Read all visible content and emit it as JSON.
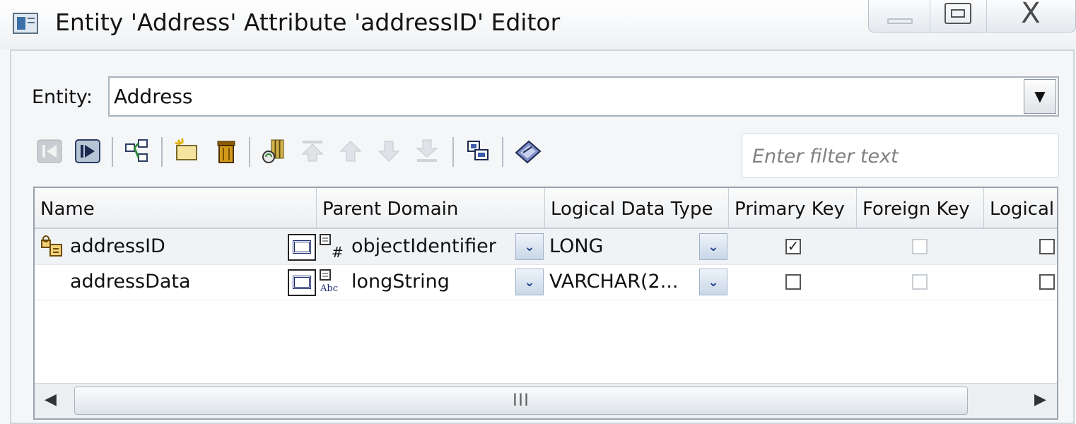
{
  "window": {
    "title": "Entity 'Address' Attribute 'addressID' Editor",
    "controls": {
      "minimize": "minimize",
      "maximize": "maximize",
      "close": "X"
    }
  },
  "entity": {
    "label": "Entity:",
    "value": "Address"
  },
  "toolbar": {
    "icons": [
      "previous-icon",
      "next-icon",
      "add-attribute-icon",
      "new-attribute-icon",
      "delete-icon",
      "reorder-icon",
      "move-top-icon",
      "move-up-icon",
      "move-down-icon",
      "move-bottom-icon",
      "copy-icon",
      "properties-icon"
    ]
  },
  "filter": {
    "placeholder": "Enter filter text",
    "value": ""
  },
  "table": {
    "columns": [
      "Name",
      "Parent Domain",
      "Logical Data Type",
      "Primary Key",
      "Foreign Key",
      "Logical"
    ],
    "rows": [
      {
        "name": "addressID",
        "parent_domain": "objectIdentifier",
        "domain_icon": "identifier-domain-icon",
        "logical_data_type": "LONG",
        "primary_key": true,
        "foreign_key": false,
        "logical": false,
        "selected": true,
        "row_icon": "primary-key-icon"
      },
      {
        "name": "addressData",
        "parent_domain": "longString",
        "domain_icon": "string-domain-icon",
        "logical_data_type": "VARCHAR(2...",
        "primary_key": false,
        "foreign_key": false,
        "logical": false,
        "selected": false,
        "row_icon": ""
      }
    ],
    "scrollbar_grip": "III"
  }
}
